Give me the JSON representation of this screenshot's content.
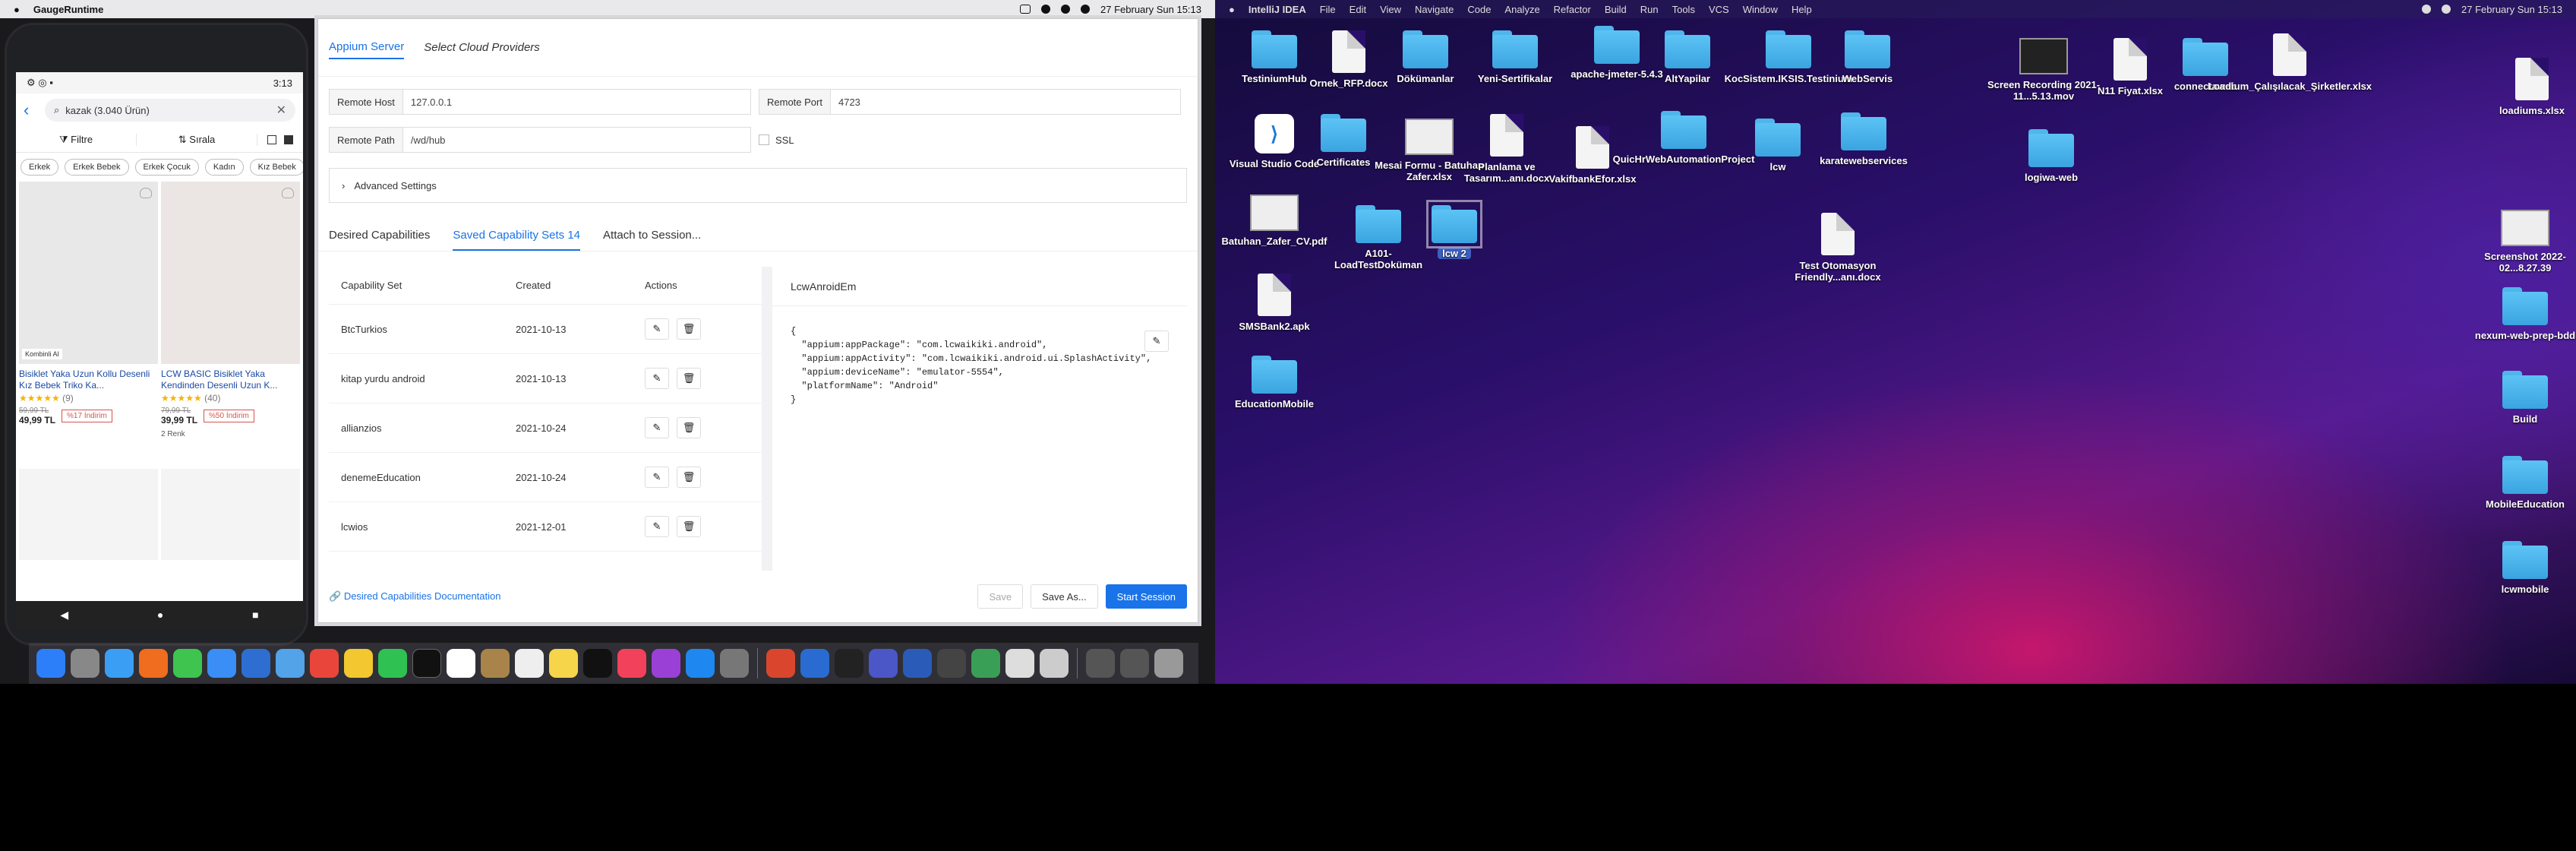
{
  "left_menubar": {
    "app_name": "GaugeRuntime",
    "date_time": "27 February Sun  15:13"
  },
  "phone": {
    "status_time": "3:13",
    "search_text": "kazak (3.040 Ürün)",
    "toolbar": {
      "filter": "Filtre",
      "sort": "Sırala"
    },
    "chips": [
      "Erkek",
      "Erkek Bebek",
      "Erkek Çocuk",
      "Kadın",
      "Kız Bebek"
    ],
    "products": [
      {
        "badge": "Kombinli Al",
        "name": "Bisiklet Yaka Uzun Kollu Desenli Kız Bebek Triko Ka...",
        "stars": "★★★★★",
        "reviews": "(9)",
        "old_price": "59,99 TL",
        "price": "49,99 TL",
        "discount": "%17 İndirim",
        "extra": ""
      },
      {
        "badge": "",
        "name": "LCW BASIC Bisiklet Yaka Kendinden Desenli Uzun K...",
        "stars": "★★★★★",
        "reviews": "(40)",
        "old_price": "79,99 TL",
        "price": "39,99 TL",
        "discount": "%50 İndirim",
        "extra": "2 Renk"
      }
    ]
  },
  "appium": {
    "tabs": [
      "Appium Server",
      "Select Cloud Providers"
    ],
    "remote_host_label": "Remote Host",
    "remote_host_value": "127.0.0.1",
    "remote_port_label": "Remote Port",
    "remote_port_value": "4723",
    "remote_path_label": "Remote Path",
    "remote_path_value": "/wd/hub",
    "ssl_label": "SSL",
    "advanced_label": "Advanced Settings",
    "cap_tabs": [
      "Desired Capabilities",
      "Saved Capability Sets 14",
      "Attach to Session..."
    ],
    "table": {
      "headers": [
        "Capability Set",
        "Created",
        "Actions"
      ],
      "rows": [
        {
          "name": "BtcTurkios",
          "date": "2021-10-13"
        },
        {
          "name": "kitap yurdu android",
          "date": "2021-10-13"
        },
        {
          "name": "allianzios",
          "date": "2021-10-24"
        },
        {
          "name": "denemeEducation",
          "date": "2021-10-24"
        },
        {
          "name": "lcwios",
          "date": "2021-12-01"
        }
      ]
    },
    "detail_title": "LcwAnroidEm",
    "detail_json": "{\n  \"appium:appPackage\": \"com.lcwaikiki.android\",\n  \"appium:appActivity\": \"com.lcwaikiki.android.ui.SplashActivity\",\n  \"appium:deviceName\": \"emulator-5554\",\n  \"platformName\": \"Android\"\n}",
    "doc_link": "Desired Capabilities Documentation",
    "buttons": {
      "save": "Save",
      "save_as": "Save As...",
      "start": "Start Session"
    },
    "accent_color": "#1a73e8"
  },
  "right_menubar": {
    "app_name": "IntelliJ IDEA",
    "menus": [
      "File",
      "Edit",
      "View",
      "Navigate",
      "Code",
      "Analyze",
      "Refactor",
      "Build",
      "Run",
      "Tools",
      "VCS",
      "Window",
      "Help"
    ],
    "date_time": "27 February Sun  15:13"
  },
  "desktop_items": [
    {
      "label": "TestiniumHub",
      "icon": "folder-icon"
    },
    {
      "label": "Ornek_RFP.docx",
      "icon": "document-icon"
    },
    {
      "label": "Dökümanlar",
      "icon": "folder-icon"
    },
    {
      "label": "Yeni-Sertifikalar",
      "icon": "folder-icon"
    },
    {
      "label": "apache-jmeter-5.4.3",
      "icon": "folder-icon"
    },
    {
      "label": "AltYapilar",
      "icon": "folder-icon"
    },
    {
      "label": "KocSistem.IKSIS.Testinium",
      "icon": "folder-icon"
    },
    {
      "label": "WebServis",
      "icon": "folder-icon"
    },
    {
      "label": "Screen Recording 2021-11...5.13.mov",
      "icon": "video-icon"
    },
    {
      "label": "N11 Fiyat.xlsx",
      "icon": "spreadsheet-icon"
    },
    {
      "label": "connectaweb",
      "icon": "folder-icon"
    },
    {
      "label": "Loadium_Çalışılacak_Şirketler.xlsx",
      "icon": "spreadsheet-icon"
    },
    {
      "label": "loadiums.xlsx",
      "icon": "spreadsheet-icon"
    },
    {
      "label": "Visual Studio Code",
      "icon": "vscode-icon"
    },
    {
      "label": "Certificates",
      "icon": "folder-icon"
    },
    {
      "label": "Mesai Formu - Batuhan Zafer.xlsx",
      "icon": "spreadsheet-icon"
    },
    {
      "label": "Planlama ve Tasarım...anı.docx",
      "icon": "document-icon"
    },
    {
      "label": "VakifbankEfor.xlsx",
      "icon": "spreadsheet-icon"
    },
    {
      "label": "QuicHrWebAutomationProject",
      "icon": "folder-icon"
    },
    {
      "label": "lcw",
      "icon": "folder-icon"
    },
    {
      "label": "karatewebservices",
      "icon": "folder-icon"
    },
    {
      "label": "logiwa-web",
      "icon": "folder-icon"
    },
    {
      "label": "Batuhan_Zafer_CV.pdf",
      "icon": "pdf-icon"
    },
    {
      "label": "A101-LoadTestDoküman",
      "icon": "folder-icon"
    },
    {
      "label": "lcw 2",
      "icon": "folder-icon"
    },
    {
      "label": "Test Otomasyon Friendly...anı.docx",
      "icon": "document-icon"
    },
    {
      "label": "Screenshot 2022-02...8.27.39",
      "icon": "image-icon"
    },
    {
      "label": "SMSBank2.apk",
      "icon": "document-icon"
    },
    {
      "label": "nexum-web-prep-bdd",
      "icon": "folder-icon"
    },
    {
      "label": "Build",
      "icon": "folder-icon"
    },
    {
      "label": "EducationMobile",
      "icon": "folder-icon"
    },
    {
      "label": "MobileEducation",
      "icon": "folder-icon"
    },
    {
      "label": "lcwmobile",
      "icon": "folder-icon"
    }
  ]
}
